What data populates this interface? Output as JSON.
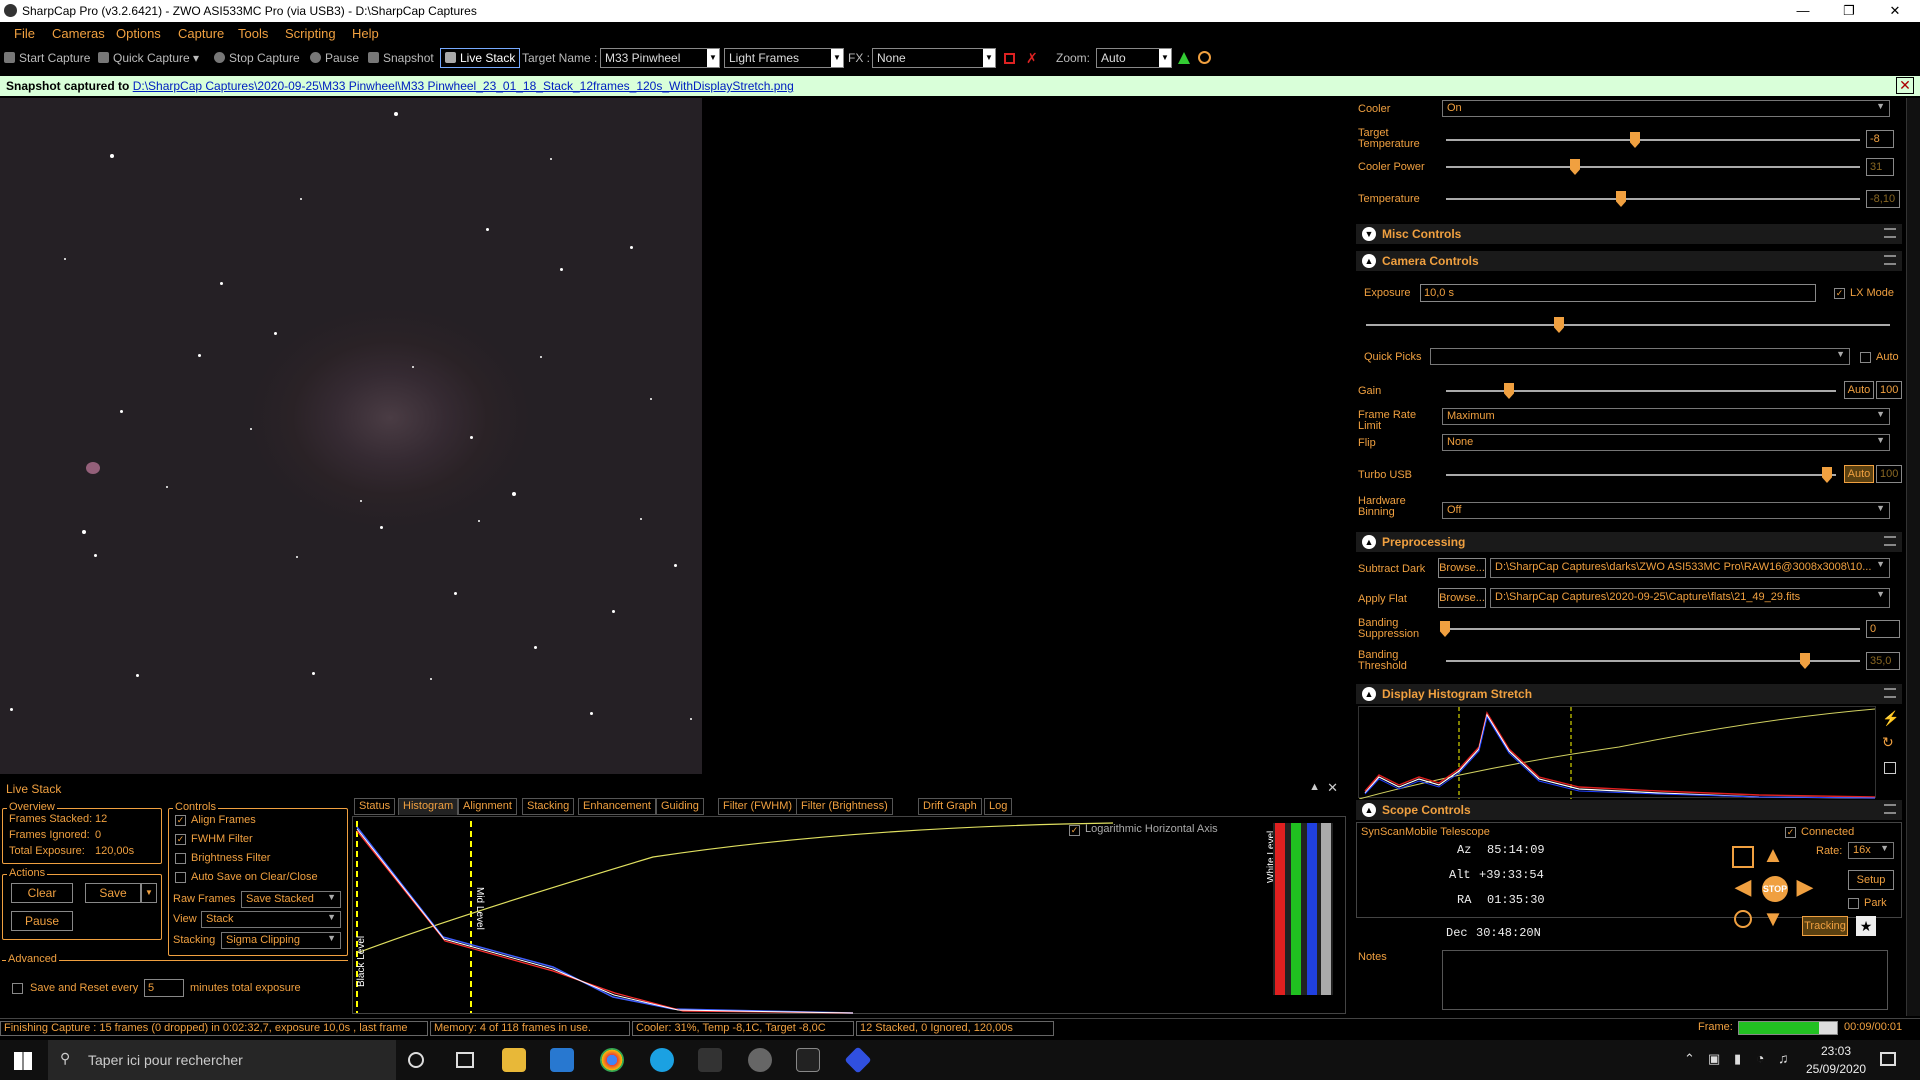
{
  "window": {
    "title": "SharpCap Pro (v3.2.6421) - ZWO ASI533MC Pro (via USB3) - D:\\SharpCap Captures"
  },
  "menu": [
    "File",
    "Cameras",
    "Options",
    "Capture",
    "Tools",
    "Scripting",
    "Help"
  ],
  "toolbar": {
    "start_capture": "Start Capture",
    "quick_capture": "Quick Capture",
    "stop_capture": "Stop Capture",
    "pause": "Pause",
    "snapshot": "Snapshot",
    "live_stack": "Live Stack",
    "target_label": "Target Name :",
    "target_value": "M33 Pinwheel",
    "frame_type": "Light Frames",
    "fx_label": "FX :",
    "fx_value": "None",
    "zoom_label": "Zoom:",
    "zoom_value": "Auto"
  },
  "snapshot_bar": {
    "label": "Snapshot captured to",
    "path": "D:\\SharpCap Captures\\2020-09-25\\M33 Pinwheel\\M33 Pinwheel_23_01_18_Stack_12frames_120s_WithDisplayStretch.png"
  },
  "live_stack": {
    "title": "Live Stack",
    "overview_label": "Overview",
    "frames_stacked_label": "Frames Stacked:",
    "frames_stacked": "12",
    "frames_ignored_label": "Frames Ignored:",
    "frames_ignored": "0",
    "total_exposure_label": "Total Exposure:",
    "total_exposure": "120,00s",
    "actions_label": "Actions",
    "clear": "Clear",
    "save": "Save",
    "pause": "Pause",
    "advanced_label": "Advanced",
    "save_reset_label": "Save and Reset every",
    "save_reset_value": "5",
    "save_reset_suffix": "minutes total exposure",
    "controls_label": "Controls",
    "align_frames": "Align Frames",
    "fwhm_filter": "FWHM Filter",
    "brightness_filter": "Brightness Filter",
    "auto_save": "Auto Save on Clear/Close",
    "raw_frames_label": "Raw Frames",
    "raw_frames_value": "Save Stacked",
    "view_label": "View",
    "view_value": "Stack",
    "stacking_label": "Stacking",
    "stacking_value": "Sigma Clipping",
    "tabs": [
      "Status",
      "Histogram",
      "Alignment",
      "Stacking",
      "Enhancement",
      "Guiding",
      "Filter (FWHM)",
      "Filter (Brightness)",
      "Drift Graph",
      "Log"
    ],
    "log_axis_label": "Logarithmic Horizontal Axis",
    "black_level": "Black Level",
    "mid_level": "Mid Level",
    "white_level": "White Level"
  },
  "right": {
    "cooler_label": "Cooler",
    "cooler_value": "On",
    "target_temp_label": "Target Temperature",
    "target_temp_value": "-8",
    "cooler_power_label": "Cooler Power",
    "cooler_power_value": "31",
    "temperature_label": "Temperature",
    "temperature_value": "-8,10",
    "misc_controls": "Misc Controls",
    "camera_controls": "Camera Controls",
    "exposure_label": "Exposure",
    "exposure_value": "10,0 s",
    "lx_mode": "LX Mode",
    "quick_picks_label": "Quick Picks",
    "auto": "Auto",
    "gain_label": "Gain",
    "gain_value": "100",
    "frame_rate_label": "Frame Rate Limit",
    "frame_rate_value": "Maximum",
    "flip_label": "Flip",
    "flip_value": "None",
    "turbo_usb_label": "Turbo USB",
    "turbo_usb_value": "100",
    "hw_binning_label": "Hardware Binning",
    "hw_binning_value": "Off",
    "preprocessing": "Preprocessing",
    "subtract_dark_label": "Subtract Dark",
    "browse": "Browse...",
    "subtract_dark_value": "D:\\SharpCap Captures\\darks\\ZWO ASI533MC Pro\\RAW16@3008x3008\\10...",
    "apply_flat_label": "Apply Flat",
    "apply_flat_value": "D:\\SharpCap Captures\\2020-09-25\\Capture\\flats\\21_49_29.fits",
    "banding_supp_label": "Banding Suppression",
    "banding_supp_value": "0",
    "banding_thresh_label": "Banding Threshold",
    "banding_thresh_value": "35,0",
    "display_histogram": "Display Histogram Stretch",
    "scope_controls": "Scope Controls",
    "telescope_name": "SynScanMobile Telescope",
    "connected": "Connected",
    "az_label": "Az",
    "az_value": "85:14:09",
    "alt_label": "Alt",
    "alt_value": "+39:33:54",
    "ra_label": "RA",
    "ra_value": "01:35:30",
    "dec_label": "Dec",
    "dec_value": "30:48:20N",
    "rate_label": "Rate:",
    "rate_value": "16x",
    "setup": "Setup",
    "park": "Park",
    "stop": "STOP",
    "tracking": "Tracking",
    "notes_label": "Notes"
  },
  "status": {
    "capture": "Finishing Capture : 15 frames (0 dropped) in 0:02:32,7, exposure 10,0s , last frame",
    "memory": "Memory: 4 of 118 frames in use.",
    "cooler": "Cooler: 31%, Temp -8,1C, Target -8,0C",
    "stacked": "12 Stacked, 0 Ignored, 120,00s",
    "frame_label": "Frame:",
    "frame_time": "00:09/00:01"
  },
  "taskbar": {
    "search_placeholder": "Taper ici pour rechercher",
    "time": "23:03",
    "date": "25/09/2020"
  }
}
